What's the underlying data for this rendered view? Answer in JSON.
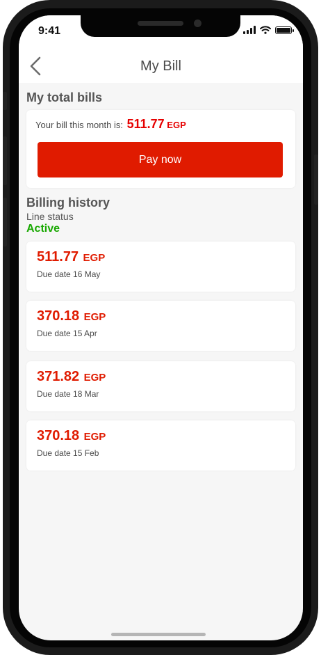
{
  "status_bar": {
    "time": "9:41"
  },
  "header": {
    "title": "My Bill"
  },
  "total_bills": {
    "section_title": "My total bills",
    "bill_text": "Your bill this month is:",
    "amount": "511.77",
    "currency": "EGP",
    "pay_button": "Pay now"
  },
  "billing_history": {
    "section_title": "Billing history",
    "line_status_label": "Line status",
    "line_status_value": "Active",
    "bills": [
      {
        "amount": "511.77",
        "currency": "EGP",
        "due": "Due date 16 May"
      },
      {
        "amount": "370.18",
        "currency": "EGP",
        "due": "Due date 15 Apr"
      },
      {
        "amount": "371.82",
        "currency": "EGP",
        "due": "Due date 18 Mar"
      },
      {
        "amount": "370.18",
        "currency": "EGP",
        "due": "Due date 15 Feb"
      }
    ]
  },
  "colors": {
    "accent": "#e01b00",
    "status_active": "#18a800",
    "background": "#f6f6f6"
  },
  "icons": {
    "back": "chevron-left-icon",
    "signal": "cellular-signal-icon",
    "wifi": "wifi-icon",
    "battery": "battery-icon"
  }
}
